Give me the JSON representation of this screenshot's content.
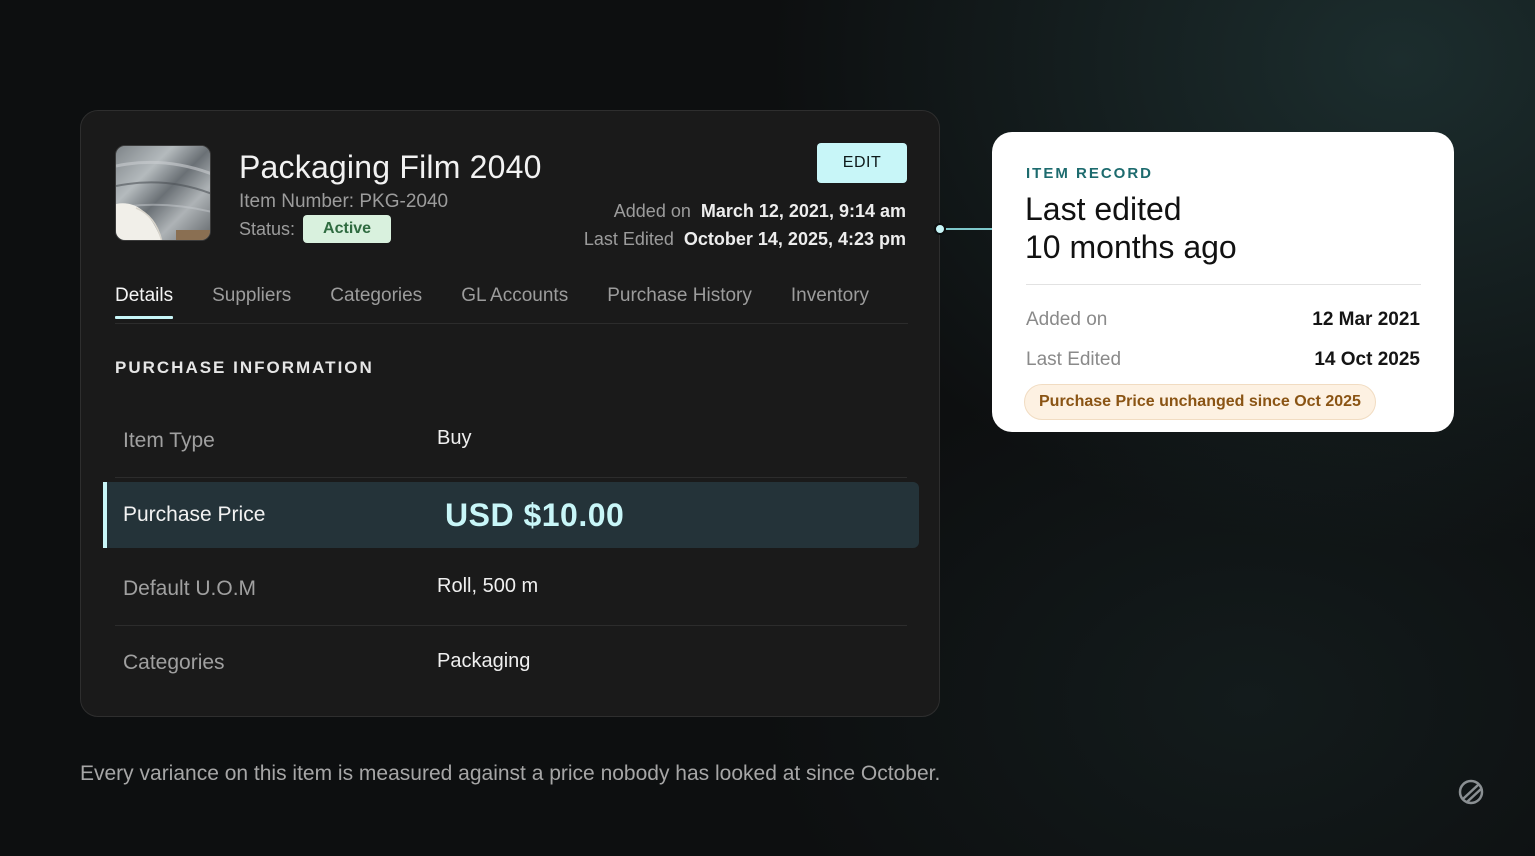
{
  "item": {
    "title": "Packaging Film 2040",
    "number": "Item Number: PKG-2040",
    "status_label": "Status:",
    "status": "Active",
    "edit_label": "EDIT",
    "added_label": "Added on",
    "added_value": "March 12, 2021, 9:14 am",
    "edited_label": "Last Edited",
    "edited_value": "October 14, 2025, 4:23 pm"
  },
  "tabs": [
    {
      "label": "Details",
      "active": true
    },
    {
      "label": "Suppliers",
      "active": false
    },
    {
      "label": "Categories",
      "active": false
    },
    {
      "label": "GL Accounts",
      "active": false
    },
    {
      "label": "Purchase History",
      "active": false
    },
    {
      "label": "Inventory",
      "active": false
    }
  ],
  "section": {
    "title": "PURCHASE INFORMATION",
    "rows": [
      {
        "label": "Item Type",
        "value": "Buy"
      },
      {
        "label": "Purchase Price",
        "value": "USD $10.00"
      },
      {
        "label": "Default U.O.M",
        "value": "Roll, 500 m"
      },
      {
        "label": "Categories",
        "value": "Packaging"
      }
    ]
  },
  "record": {
    "kicker": "ITEM RECORD",
    "headline_line1": "Last edited",
    "headline_line2": "10 months ago",
    "added_label": "Added on",
    "added_value": "12 Mar 2021",
    "edited_label": "Last Edited",
    "edited_value": "14 Oct 2025",
    "pill": "Purchase Price unchanged since Oct 2025"
  },
  "footer": {
    "note": "Every variance on this item is measured against a price nobody has looked at since October."
  },
  "colors": {
    "accent": "#c8f6f8",
    "status_bg": "#d9f1de",
    "status_text": "#2f6b40",
    "kicker": "#1d6b6e",
    "pill_text": "#8a5414"
  },
  "icons": {
    "brand": "slashed-circle-logo-icon"
  }
}
